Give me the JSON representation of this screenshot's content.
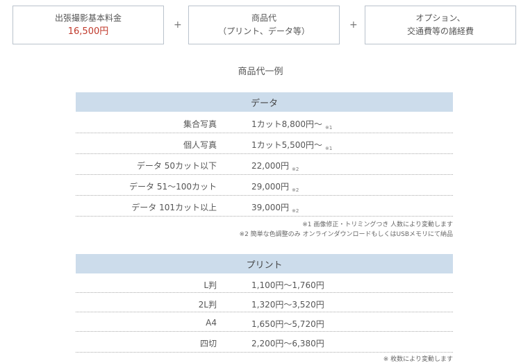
{
  "top_boxes": [
    {
      "line1": "出張撮影基本料金",
      "line2": "16,500円"
    },
    {
      "line1": "商品代",
      "line2": "（プリント、データ等）"
    },
    {
      "line1": "オプション、",
      "line2": "交通費等の諸経費"
    }
  ],
  "plus_sign": "+",
  "subtitle": "商品代一例",
  "data_section": {
    "header": "データ",
    "rows": [
      {
        "label": "集合写真",
        "value": "1カット8,800円～",
        "note": "※1"
      },
      {
        "label": "個人写真",
        "value": "1カット5,500円～",
        "note": "※1"
      },
      {
        "label": "データ 50カット以下",
        "value": "22,000円",
        "note": "※2"
      },
      {
        "label": "データ 51～100カット",
        "value": "29,000円",
        "note": "※2"
      },
      {
        "label": "データ 101カット以上",
        "value": "39,000円",
        "note": "※2"
      }
    ],
    "footnotes": [
      "※1 画像修正・トリミングつき 人数により変動します",
      "※2 簡単な色調整のみ オンラインダウンロードもしくはUSBメモリにて納品"
    ]
  },
  "print_section": {
    "header": "プリント",
    "rows": [
      {
        "label": "L判",
        "value": "1,100円～1,760円"
      },
      {
        "label": "2L判",
        "value": "1,320円～3,520円"
      },
      {
        "label": "A4",
        "value": "1,650円～5,720円"
      },
      {
        "label": "四切",
        "value": "2,200円～6,380円"
      }
    ],
    "footnote": "※ 枚数により変動します"
  }
}
